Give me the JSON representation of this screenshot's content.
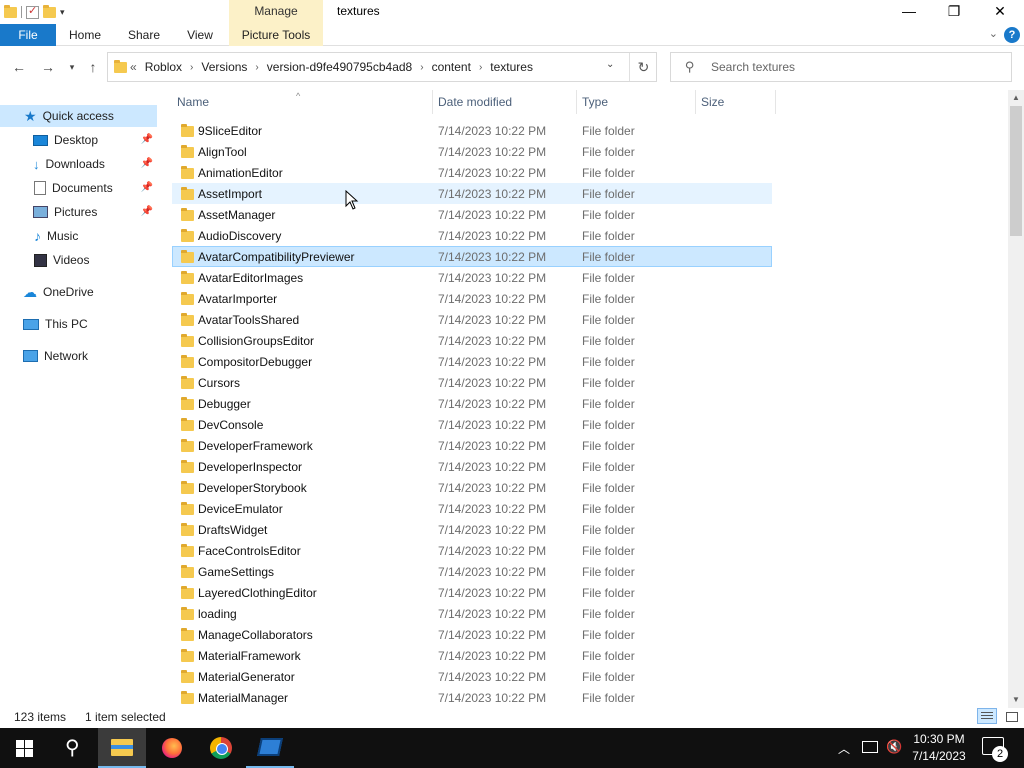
{
  "titlebar": {
    "title": "textures",
    "manage_label": "Manage"
  },
  "ribbon": {
    "tabs": [
      "File",
      "Home",
      "Share",
      "View",
      "Picture Tools"
    ]
  },
  "address": {
    "lead": "«",
    "crumbs": [
      "Roblox",
      "Versions",
      "version-d9fe490795cb4ad8",
      "content",
      "textures"
    ]
  },
  "search": {
    "placeholder": "Search textures"
  },
  "nav": {
    "quick_access": "Quick access",
    "pinned": [
      "Desktop",
      "Downloads",
      "Documents",
      "Pictures"
    ],
    "items": [
      "Music",
      "Videos"
    ],
    "onedrive": "OneDrive",
    "this_pc": "This PC",
    "network": "Network"
  },
  "columns": {
    "name": "Name",
    "date": "Date modified",
    "type": "Type",
    "size": "Size"
  },
  "files": [
    {
      "name": "9SliceEditor",
      "date": "7/14/2023 10:22 PM",
      "type": "File folder"
    },
    {
      "name": "AlignTool",
      "date": "7/14/2023 10:22 PM",
      "type": "File folder"
    },
    {
      "name": "AnimationEditor",
      "date": "7/14/2023 10:22 PM",
      "type": "File folder"
    },
    {
      "name": "AssetImport",
      "date": "7/14/2023 10:22 PM",
      "type": "File folder"
    },
    {
      "name": "AssetManager",
      "date": "7/14/2023 10:22 PM",
      "type": "File folder"
    },
    {
      "name": "AudioDiscovery",
      "date": "7/14/2023 10:22 PM",
      "type": "File folder"
    },
    {
      "name": "AvatarCompatibilityPreviewer",
      "date": "7/14/2023 10:22 PM",
      "type": "File folder"
    },
    {
      "name": "AvatarEditorImages",
      "date": "7/14/2023 10:22 PM",
      "type": "File folder"
    },
    {
      "name": "AvatarImporter",
      "date": "7/14/2023 10:22 PM",
      "type": "File folder"
    },
    {
      "name": "AvatarToolsShared",
      "date": "7/14/2023 10:22 PM",
      "type": "File folder"
    },
    {
      "name": "CollisionGroupsEditor",
      "date": "7/14/2023 10:22 PM",
      "type": "File folder"
    },
    {
      "name": "CompositorDebugger",
      "date": "7/14/2023 10:22 PM",
      "type": "File folder"
    },
    {
      "name": "Cursors",
      "date": "7/14/2023 10:22 PM",
      "type": "File folder"
    },
    {
      "name": "Debugger",
      "date": "7/14/2023 10:22 PM",
      "type": "File folder"
    },
    {
      "name": "DevConsole",
      "date": "7/14/2023 10:22 PM",
      "type": "File folder"
    },
    {
      "name": "DeveloperFramework",
      "date": "7/14/2023 10:22 PM",
      "type": "File folder"
    },
    {
      "name": "DeveloperInspector",
      "date": "7/14/2023 10:22 PM",
      "type": "File folder"
    },
    {
      "name": "DeveloperStorybook",
      "date": "7/14/2023 10:22 PM",
      "type": "File folder"
    },
    {
      "name": "DeviceEmulator",
      "date": "7/14/2023 10:22 PM",
      "type": "File folder"
    },
    {
      "name": "DraftsWidget",
      "date": "7/14/2023 10:22 PM",
      "type": "File folder"
    },
    {
      "name": "FaceControlsEditor",
      "date": "7/14/2023 10:22 PM",
      "type": "File folder"
    },
    {
      "name": "GameSettings",
      "date": "7/14/2023 10:22 PM",
      "type": "File folder"
    },
    {
      "name": "LayeredClothingEditor",
      "date": "7/14/2023 10:22 PM",
      "type": "File folder"
    },
    {
      "name": "loading",
      "date": "7/14/2023 10:22 PM",
      "type": "File folder"
    },
    {
      "name": "ManageCollaborators",
      "date": "7/14/2023 10:22 PM",
      "type": "File folder"
    },
    {
      "name": "MaterialFramework",
      "date": "7/14/2023 10:22 PM",
      "type": "File folder"
    },
    {
      "name": "MaterialGenerator",
      "date": "7/14/2023 10:22 PM",
      "type": "File folder"
    },
    {
      "name": "MaterialManager",
      "date": "7/14/2023 10:22 PM",
      "type": "File folder"
    }
  ],
  "hover_index": 3,
  "selected_index": 6,
  "status": {
    "count": "123 items",
    "selection": "1 item selected"
  },
  "taskbar": {
    "time": "10:30 PM",
    "date": "7/14/2023",
    "notifications": "2"
  },
  "colors": {
    "accent": "#1979ca",
    "selection": "#cce8ff",
    "hover": "#e5f3ff",
    "manage_tab": "#fcf1c8"
  }
}
